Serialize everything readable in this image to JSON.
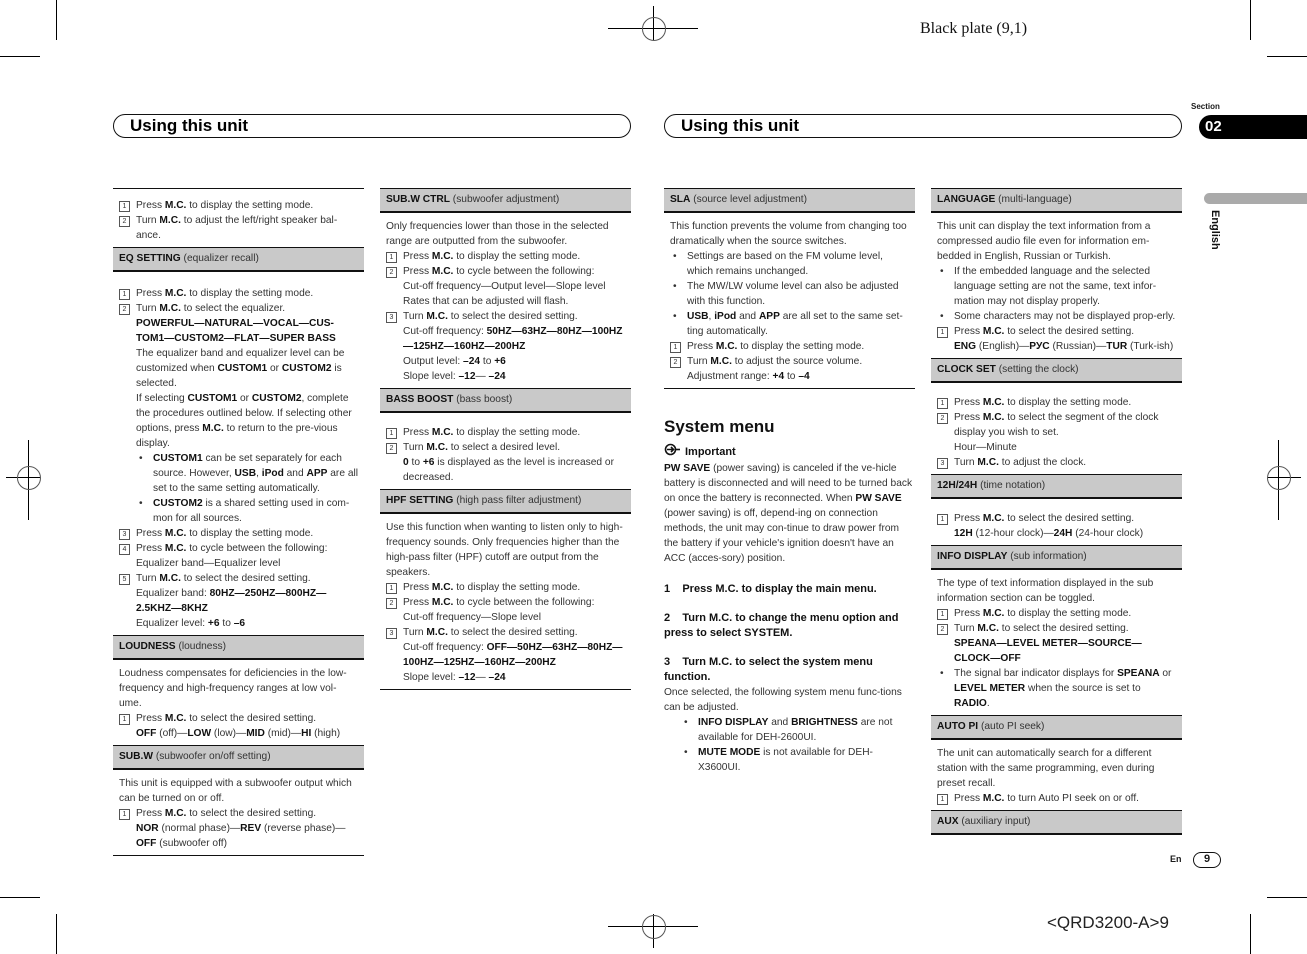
{
  "plate_label": "Black plate (9,1)",
  "doc_code": "<QRD3200-A>9",
  "header_left": "Using this unit",
  "header_right": "Using this unit",
  "section": {
    "label": "Section",
    "number": "02"
  },
  "language_tab": "English",
  "footer": {
    "lang": "En",
    "page": "9"
  },
  "col1": {
    "intro_steps": [
      {
        "n": "1",
        "html": "Press <b>M.C.</b> to display the setting mode."
      },
      {
        "n": "2",
        "html": "Turn <b>M.C.</b> to adjust the left/right speaker bal-ance."
      }
    ],
    "eq": {
      "title": "EQ SETTING",
      "desc": "(equalizer recall)",
      "s1": "Press <b>M.C.</b> to display the setting mode.",
      "s2": "Turn <b>M.C.</b> to select the equalizer.",
      "s2_options": "<b>POWERFUL—NATURAL—VOCAL—CUS-TOM1—CUSTOM2—FLAT—SUPER BASS</b>",
      "s2_note1": "The equalizer band and equalizer level can be customized when <b>CUSTOM1</b> or <b>CUSTOM2</b> is selected.",
      "s2_note2": "If selecting <b>CUSTOM1</b> or <b>CUSTOM2</b>, complete the procedures outlined below. If selecting other options, press <b>M.C.</b> to return to the pre-vious display.",
      "bullet1": "<b>CUSTOM1</b> can be set separately for each source. However, <b>USB</b>, <b>iPod</b> and <b>APP</b> are all set to the same setting automatically.",
      "bullet2": "<b>CUSTOM2</b> is a shared setting used in com-mon for all sources.",
      "s3": "Press <b>M.C.</b> to display the setting mode.",
      "s4": "Press <b>M.C.</b> to cycle between the following:",
      "s4_opt": "Equalizer band—Equalizer level",
      "s5": "Turn <b>M.C.</b> to select the desired setting.",
      "s5_band": "Equalizer band: <b>80HZ—250HZ—800HZ—2.5KHZ—8KHZ</b>",
      "s5_level": "Equalizer level: <b>+6</b> to <b>–6</b>"
    },
    "loudness": {
      "title": "LOUDNESS",
      "desc": "(loudness)",
      "text": "Loudness compensates for deficiencies in the low-frequency and high-frequency ranges at low vol-ume.",
      "s1": "Press <b>M.C.</b> to select the desired setting.",
      "s1_opt": "<b>OFF</b> (off)—<b>LOW</b> (low)—<b>MID</b> (mid)—<b>HI</b> (high)"
    },
    "subw": {
      "title": "SUB.W",
      "desc": "(subwoofer on/off setting)",
      "text": "This unit is equipped with a subwoofer output which can be turned on or off.",
      "s1": "Press <b>M.C.</b> to select the desired setting.",
      "s1_opt": "<b>NOR</b> (normal phase)—<b>REV</b> (reverse phase)—<b>OFF</b> (subwoofer off)"
    }
  },
  "col2": {
    "subwctrl": {
      "title": "SUB.W CTRL",
      "desc": "(subwoofer adjustment)",
      "text": "Only frequencies lower than those in the selected range are outputted from the subwoofer.",
      "s1": "Press <b>M.C.</b> to display the setting mode.",
      "s2": "Press <b>M.C.</b> to cycle between the following:",
      "s2_opt": "Cut-off frequency—Output level—Slope level",
      "s2_note": "Rates that can be adjusted will flash.",
      "s3": "Turn <b>M.C.</b> to select the desired setting.",
      "s3_cut": "Cut-off frequency: <b>50HZ—63HZ—80HZ—100HZ—125HZ—160HZ—200HZ</b>",
      "s3_out": "Output level: <b>–24</b> to <b>+6</b>",
      "s3_slope": "Slope level: <b>–12</b>— <b>–24</b>"
    },
    "bassboost": {
      "title": "BASS BOOST",
      "desc": "(bass boost)",
      "s1": "Press <b>M.C.</b> to display the setting mode.",
      "s2": "Turn <b>M.C.</b> to select a desired level.",
      "s2_note": "<b>0</b> to <b>+6</b> is displayed as the level is increased or decreased."
    },
    "hpf": {
      "title": "HPF SETTING",
      "desc": "(high pass filter adjustment)",
      "text": "Use this function when wanting to listen only to high-frequency sounds. Only frequencies higher than the high-pass filter (HPF) cutoff are output from the speakers.",
      "s1": "Press <b>M.C.</b> to display the setting mode.",
      "s2": "Press <b>M.C.</b> to cycle between the following:",
      "s2_opt": "Cut-off frequency—Slope level",
      "s3": "Turn <b>M.C.</b> to select the desired setting.",
      "s3_cut": "Cut-off frequency: <b>OFF—50HZ—63HZ—80HZ—100HZ—125HZ—160HZ—200HZ</b>",
      "s3_slope": "Slope level: <b>–12</b>— <b>–24</b>"
    }
  },
  "col3": {
    "sla": {
      "title": "SLA",
      "desc": "(source level adjustment)",
      "text": "This function prevents the volume from changing too dramatically when the source switches.",
      "b1": "Settings are based on the FM volume level, which remains unchanged.",
      "b2": "The MW/LW volume level can also be adjusted with this function.",
      "b3": "<b>USB</b>, <b>iPod</b> and <b>APP</b> are all set to the same set-ting automatically.",
      "s1": "Press <b>M.C.</b> to display the setting mode.",
      "s2": "Turn <b>M.C.</b> to adjust the source volume.",
      "s2_range": "Adjustment range: <b>+4</b> to <b>–4</b>"
    },
    "system": {
      "title": "System menu",
      "important": "Important",
      "important_text": "<b>PW SAVE</b> (power saving) is canceled if the ve-hicle battery is disconnected and will need to be turned back on once the battery is reconnected. When <b>PW SAVE</b> (power saving) is off, depend-ing on connection methods, the unit may con-tinue to draw power from the battery if your vehicle's ignition doesn't have an ACC (acces-sory) position.",
      "step1": "1 &nbsp;&nbsp; Press M.C. to display the main menu.",
      "step2": "2 &nbsp;&nbsp; Turn M.C. to change the menu option and press to select SYSTEM.",
      "step3": "3 &nbsp;&nbsp; Turn M.C. to select the system menu function.",
      "step3_text": "Once selected, the following system menu func-tions can be adjusted.",
      "b1": "<b>INFO DISPLAY</b> and <b>BRIGHTNESS</b> are not available for DEH-2600UI.",
      "b2": "<b>MUTE MODE</b> is not available for DEH-X3600UI."
    }
  },
  "col4": {
    "language": {
      "title": "LANGUAGE",
      "desc": "(multi-language)",
      "text": "This unit can display the text information from a compressed audio file even for information em-bedded in English, Russian or Turkish.",
      "b1": "If the embedded language and the selected language setting are not the same, text infor-mation may not display properly.",
      "b2": "Some characters may not be displayed prop-erly.",
      "s1": "Press <b>M.C.</b> to select the desired setting.",
      "s1_opt": "<b>ENG</b> (English)—<b>РУС</b> (Russian)—<b>TUR</b> (Turk-ish)"
    },
    "clock": {
      "title": "CLOCK SET",
      "desc": "(setting the clock)",
      "s1": "Press <b>M.C.</b> to display the setting mode.",
      "s2": "Press <b>M.C.</b> to select the segment of the clock display you wish to set.",
      "s2_opt": "Hour—Minute",
      "s3": "Turn <b>M.C.</b> to adjust the clock."
    },
    "h1224": {
      "title": "12H/24H",
      "desc": "(time notation)",
      "s1": "Press <b>M.C.</b> to select the desired setting.",
      "s1_opt": "<b>12H</b> (12-hour clock)—<b>24H</b> (24-hour clock)"
    },
    "info": {
      "title": "INFO DISPLAY",
      "desc": "(sub information)",
      "text": "The type of text information displayed in the sub information section can be toggled.",
      "s1": "Press <b>M.C.</b> to display the setting mode.",
      "s2": "Turn <b>M.C.</b> to select the desired setting.",
      "s2_opt": "<b>SPEANA—LEVEL METER—SOURCE—CLOCK—OFF</b>",
      "b1": "The signal bar indicator displays for <b>SPEANA</b> or <b>LEVEL METER</b> when the source is set to <b>RADIO</b>."
    },
    "autopi": {
      "title": "AUTO PI",
      "desc": "(auto PI seek)",
      "text": "The unit can automatically search for a different station with the same programming, even during preset recall.",
      "s1": "Press <b>M.C.</b> to turn Auto PI seek on or off."
    },
    "aux": {
      "title": "AUX",
      "desc": "(auxiliary input)"
    }
  }
}
